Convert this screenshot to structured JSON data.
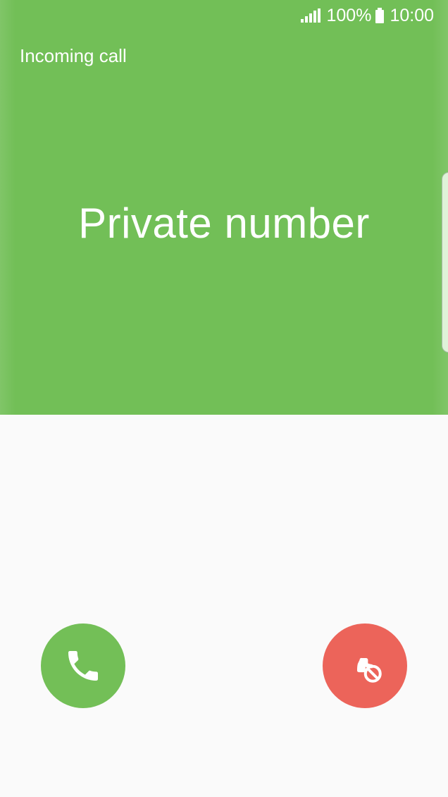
{
  "status_bar": {
    "battery": "100%",
    "time": "10:00",
    "signal_icon": "signal-icon",
    "battery_icon": "battery-icon"
  },
  "call": {
    "label": "Incoming call",
    "caller": "Private number"
  },
  "actions": {
    "accept_icon": "phone-accept-icon",
    "reject_icon": "phone-reject-icon"
  },
  "colors": {
    "accent_green": "#72bf57",
    "reject_red": "#ec645a",
    "background": "#fafafa"
  }
}
